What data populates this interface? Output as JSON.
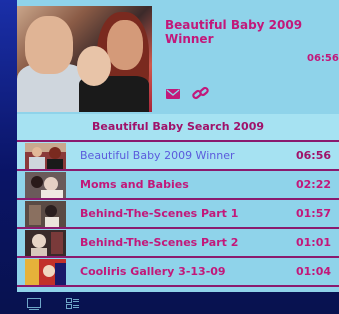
{
  "now_playing": {
    "title": "Beautiful Baby 2009 Winner",
    "duration": "06:56",
    "actions": [
      "mail-icon",
      "link-icon"
    ]
  },
  "playlist": {
    "title": "Beautiful Baby Search 2009",
    "items": [
      {
        "title": "Beautiful Baby 2009 Winner",
        "duration": "06:56",
        "selected": true
      },
      {
        "title": "Moms and Babies",
        "duration": "02:22",
        "selected": false
      },
      {
        "title": "Behind-The-Scenes Part 1",
        "duration": "01:57",
        "selected": false
      },
      {
        "title": "Behind-The-Scenes Part 2",
        "duration": "01:01",
        "selected": false
      },
      {
        "title": "Cooliris Gallery 3-13-09",
        "duration": "01:04",
        "selected": false
      }
    ]
  },
  "footer": {
    "view_modes": [
      "single-view-icon",
      "list-view-icon"
    ]
  },
  "colors": {
    "panel": "#8fd3ea",
    "accent": "#c2187a",
    "selected_text": "#5b5bdc",
    "background": "#0d1a6e"
  }
}
